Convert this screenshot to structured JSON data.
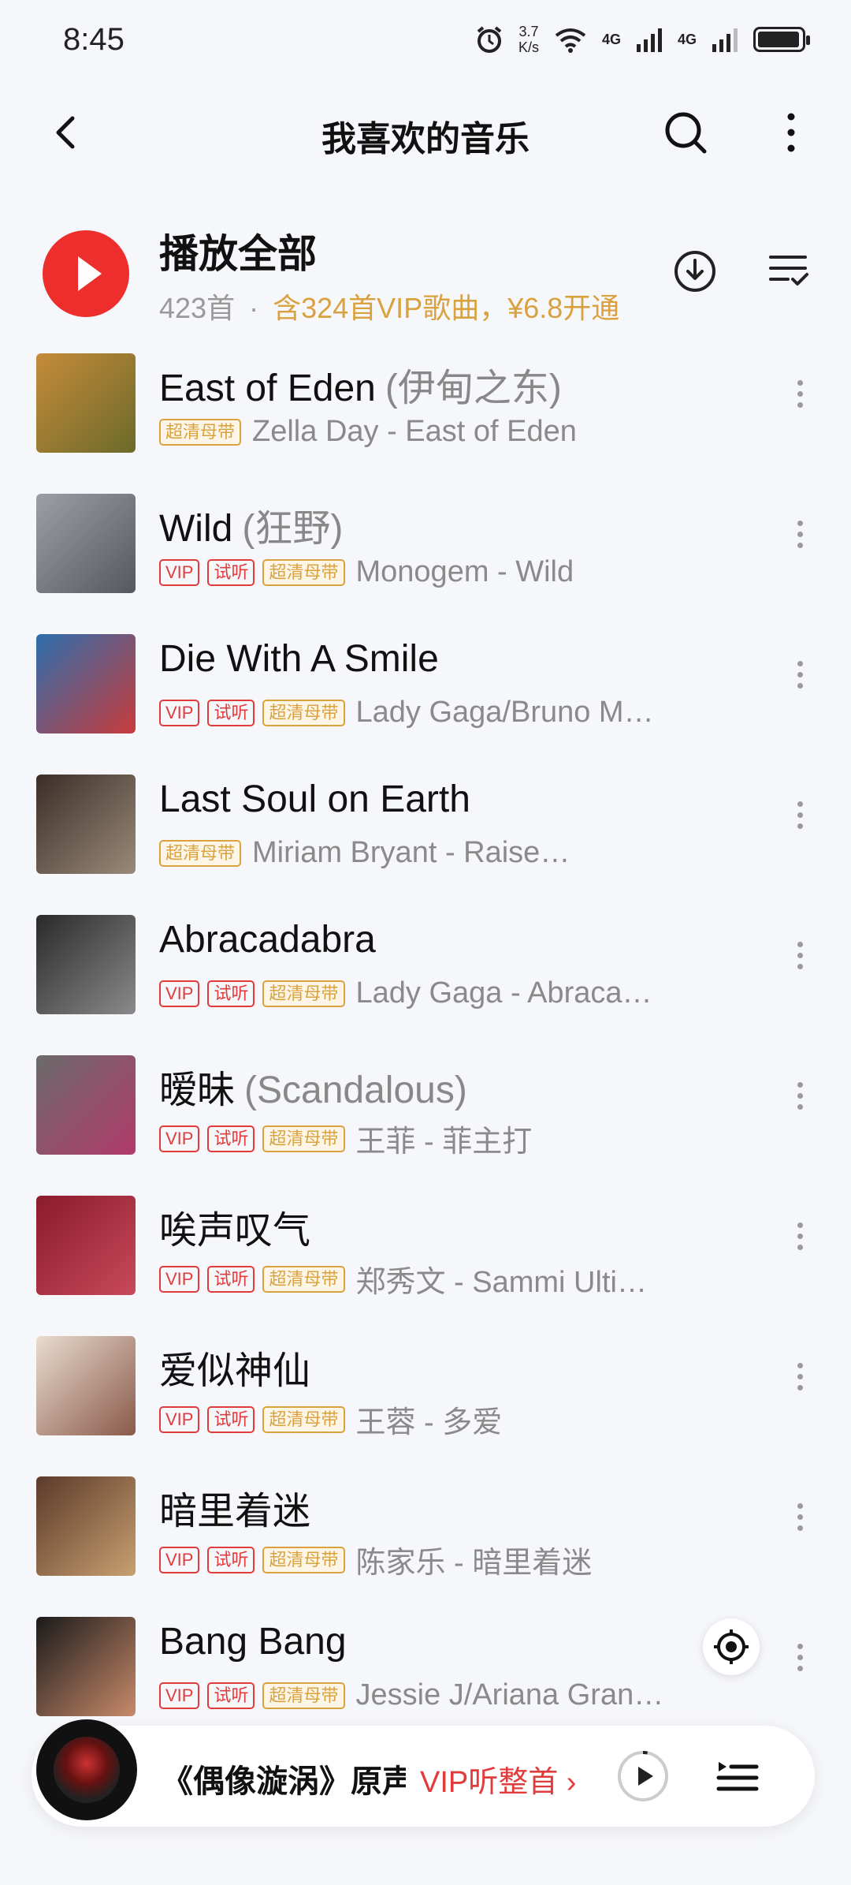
{
  "status_bar": {
    "time": "8:45",
    "net_speed_value": "3.7",
    "net_speed_unit": "K/s",
    "network_1": "4G",
    "network_2": "4G",
    "icons": [
      "alarm-icon",
      "wifi-icon",
      "signal-icon",
      "signal-icon",
      "battery-icon"
    ]
  },
  "header": {
    "title": "我喜欢的音乐",
    "back_icon": "back-icon",
    "search_icon": "search-icon",
    "more_icon": "more-vertical-icon"
  },
  "play_all": {
    "label": "播放全部",
    "count": "423首",
    "separator": "·",
    "vip_text": "含324首VIP歌曲，¥6.8开通",
    "download_icon": "download-icon",
    "sort_icon": "sort-list-icon"
  },
  "songs": [
    {
      "title": "East of Eden",
      "alt": "(伊甸之东)",
      "tags": [
        "超清母带"
      ],
      "artist": "Zella Day - East of Eden",
      "cover": [
        "#c58b3a",
        "#6b6a2a"
      ]
    },
    {
      "title": "Wild",
      "alt": "(狂野)",
      "tags": [
        "VIP",
        "试听",
        "超清母带"
      ],
      "artist": "Monogem - Wild",
      "cover": [
        "#9ca0a6",
        "#55585e"
      ]
    },
    {
      "title": "Die With A Smile",
      "alt": "",
      "tags": [
        "VIP",
        "试听",
        "超清母带"
      ],
      "artist": "Lady Gaga/Bruno M…",
      "cover": [
        "#2d6fae",
        "#c83b3b"
      ]
    },
    {
      "title": "Last Soul on Earth",
      "alt": "",
      "tags": [
        "超清母带"
      ],
      "artist": "Miriam Bryant - Raised in Rain",
      "cover": [
        "#3a2e28",
        "#9a8a78"
      ]
    },
    {
      "title": "Abracadabra",
      "alt": "",
      "tags": [
        "VIP",
        "试听",
        "超清母带"
      ],
      "artist": "Lady Gaga - Abraca…",
      "cover": [
        "#2a2a2a",
        "#8a8a8a"
      ]
    },
    {
      "title": "暧昧",
      "alt": "(Scandalous)",
      "tags": [
        "VIP",
        "试听",
        "超清母带"
      ],
      "artist": "王菲 - 菲主打",
      "cover": [
        "#6b6b6b",
        "#b23a6a"
      ]
    },
    {
      "title": "唉声叹气",
      "alt": "",
      "tags": [
        "VIP",
        "试听",
        "超清母带"
      ],
      "artist": "郑秀文 - Sammi Ulti…",
      "cover": [
        "#8a1a2a",
        "#c84a5a"
      ]
    },
    {
      "title": "爱似神仙",
      "alt": "",
      "tags": [
        "VIP",
        "试听",
        "超清母带"
      ],
      "artist": "王蓉 - 多爱",
      "cover": [
        "#e9dccf",
        "#8a5a4a"
      ]
    },
    {
      "title": "暗里着迷",
      "alt": "",
      "tags": [
        "VIP",
        "试听",
        "超清母带"
      ],
      "artist": "陈家乐 - 暗里着迷",
      "cover": [
        "#5a3a2a",
        "#c8a070"
      ]
    },
    {
      "title": "Bang Bang",
      "alt": "",
      "tags": [
        "VIP",
        "试听",
        "超清母带"
      ],
      "artist": "Jessie J/Ariana Gran…",
      "cover": [
        "#1a1a1a",
        "#c88a6a"
      ]
    }
  ],
  "locate_icon": "locate-icon",
  "player": {
    "title": "《偶像漩涡》原声",
    "vip_text": "VIP听整首 ›",
    "play_icon": "play-icon",
    "playlist_icon": "playlist-icon",
    "progress": 0.03
  },
  "colors": {
    "accent_red": "#ee2d2d",
    "vip_gold": "#d9a23f",
    "background": "#f6f7fb"
  }
}
